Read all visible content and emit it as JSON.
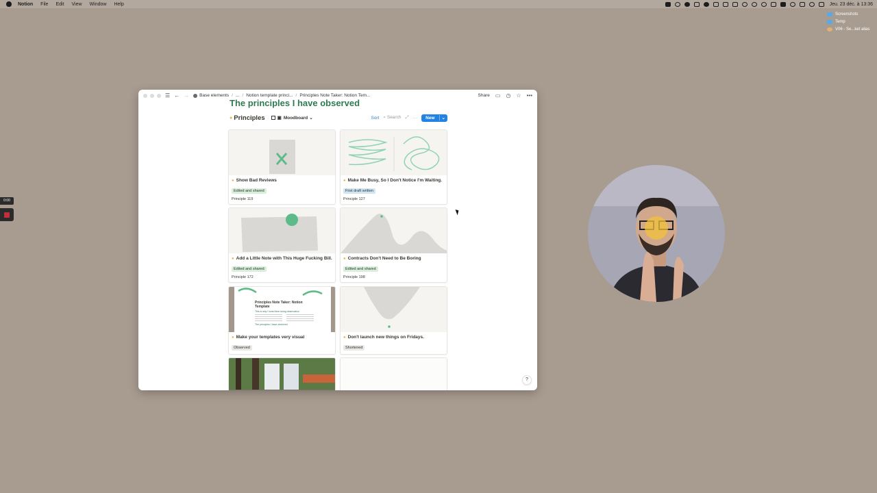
{
  "menubar": {
    "app": "Notion",
    "items": [
      "File",
      "Edit",
      "View",
      "Window",
      "Help"
    ],
    "clock": "Jeu. 23 déc. à 13:36"
  },
  "desktop": {
    "files": [
      {
        "label": "Screenshots",
        "icon": "folder-icon"
      },
      {
        "label": "Temp",
        "icon": "folder-icon"
      },
      {
        "label": "V06 - Se...ket alias",
        "icon": "image-file-icon"
      }
    ]
  },
  "recorder": {
    "timer": "0:00"
  },
  "window": {
    "breadcrumb": [
      {
        "label": "Base elements",
        "icon": "workspace-icon"
      },
      {
        "label": "..."
      },
      {
        "label": "Notion template princi..."
      },
      {
        "label": "Principles Note Taker: Notion Tem..."
      }
    ],
    "share_label": "Share",
    "page_title": "The principles I have observed",
    "database": {
      "title": "Principles",
      "view_name": "Moodboard",
      "sort_label": "Sort",
      "search_label": "Search",
      "new_label": "New"
    },
    "cards": [
      {
        "title": "Show Bad Reviews",
        "tag": "Edited and shared",
        "tag_color": "green",
        "property": "Principle 119"
      },
      {
        "title": "Make Me Busy, So I Don't Notice I'm Waiting.",
        "tag": "First draft written",
        "tag_color": "blue",
        "property": "Principle 127"
      },
      {
        "title": "Add a Little Note with This Huge Fucking Bill.",
        "tag": "Edited and shared",
        "tag_color": "green",
        "property": "Principle 172"
      },
      {
        "title": "Contracts Don't Need to Be Boring",
        "tag": "Edited and shared",
        "tag_color": "green",
        "property": "Principle 198"
      },
      {
        "title": "Make your templates very visual",
        "tag": "Observed",
        "tag_color": "gray",
        "property": ""
      },
      {
        "title": "Don't launch new things on Fridays.",
        "tag": "Shortened",
        "tag_color": "gray",
        "property": ""
      }
    ],
    "card3_cover": {
      "title": "Principles Note Taker: Notion Template",
      "subtitle": "This is why I loved time doing observation",
      "section": "The principles I have observed"
    },
    "help_label": "?"
  },
  "colors": {
    "desktop": "#a89c91",
    "title_green": "#2f7a50",
    "accent_blue": "#2383e2",
    "illustration_green": "#5dbb8a"
  }
}
